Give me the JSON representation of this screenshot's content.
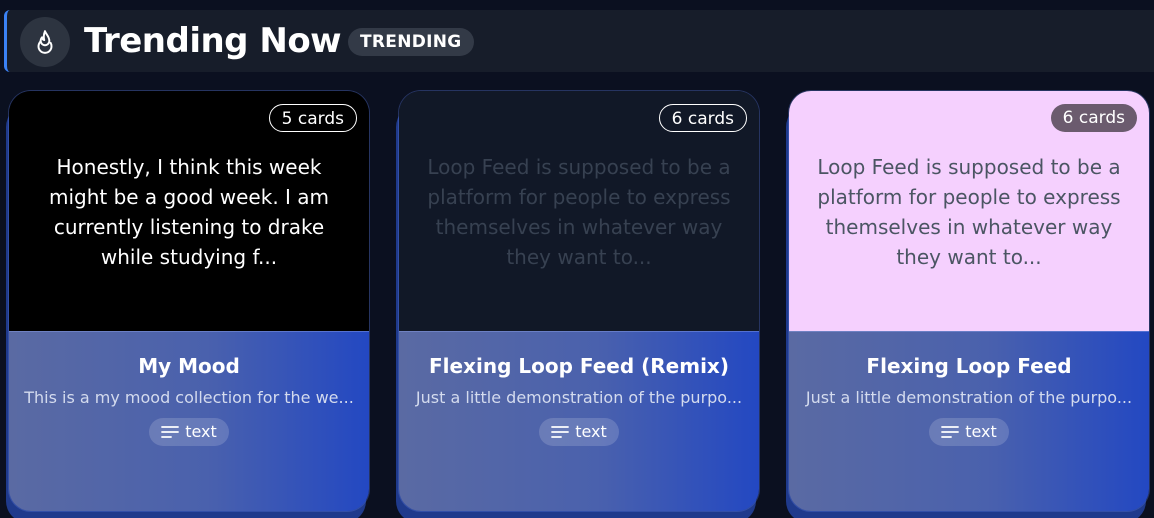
{
  "header": {
    "icon": "fire-icon",
    "title": "Trending Now",
    "badge": "TRENDING",
    "accent_color": "#3b82f6"
  },
  "cards": [
    {
      "count": "5 cards",
      "preview_text": "Honestly, I think this week might be a good week. I am currently listening to drake while studying f...",
      "preview_bg": "#000000",
      "preview_color": "#ffffff",
      "title": "My Mood",
      "description": "This is a my mood collection for the we...",
      "type_icon": "text-lines-icon",
      "type_label": "text"
    },
    {
      "count": "6 cards",
      "preview_text": "Loop Feed is supposed to be a platform for people to express themselves in whatever way they want to...",
      "preview_bg": "#111827",
      "preview_color": "#374151",
      "title": "Flexing Loop Feed (Remix)",
      "description": "Just a little demonstration of the purpo...",
      "type_icon": "text-lines-icon",
      "type_label": "text"
    },
    {
      "count": "6 cards",
      "preview_text": "Loop Feed is supposed to be a platform for people to express themselves in whatever way they want to...",
      "preview_bg": "#f5d0fe",
      "preview_color": "#4b5563",
      "title": "Flexing Loop Feed",
      "description": "Just a little demonstration of the purpo...",
      "type_icon": "text-lines-icon",
      "type_label": "text"
    }
  ]
}
